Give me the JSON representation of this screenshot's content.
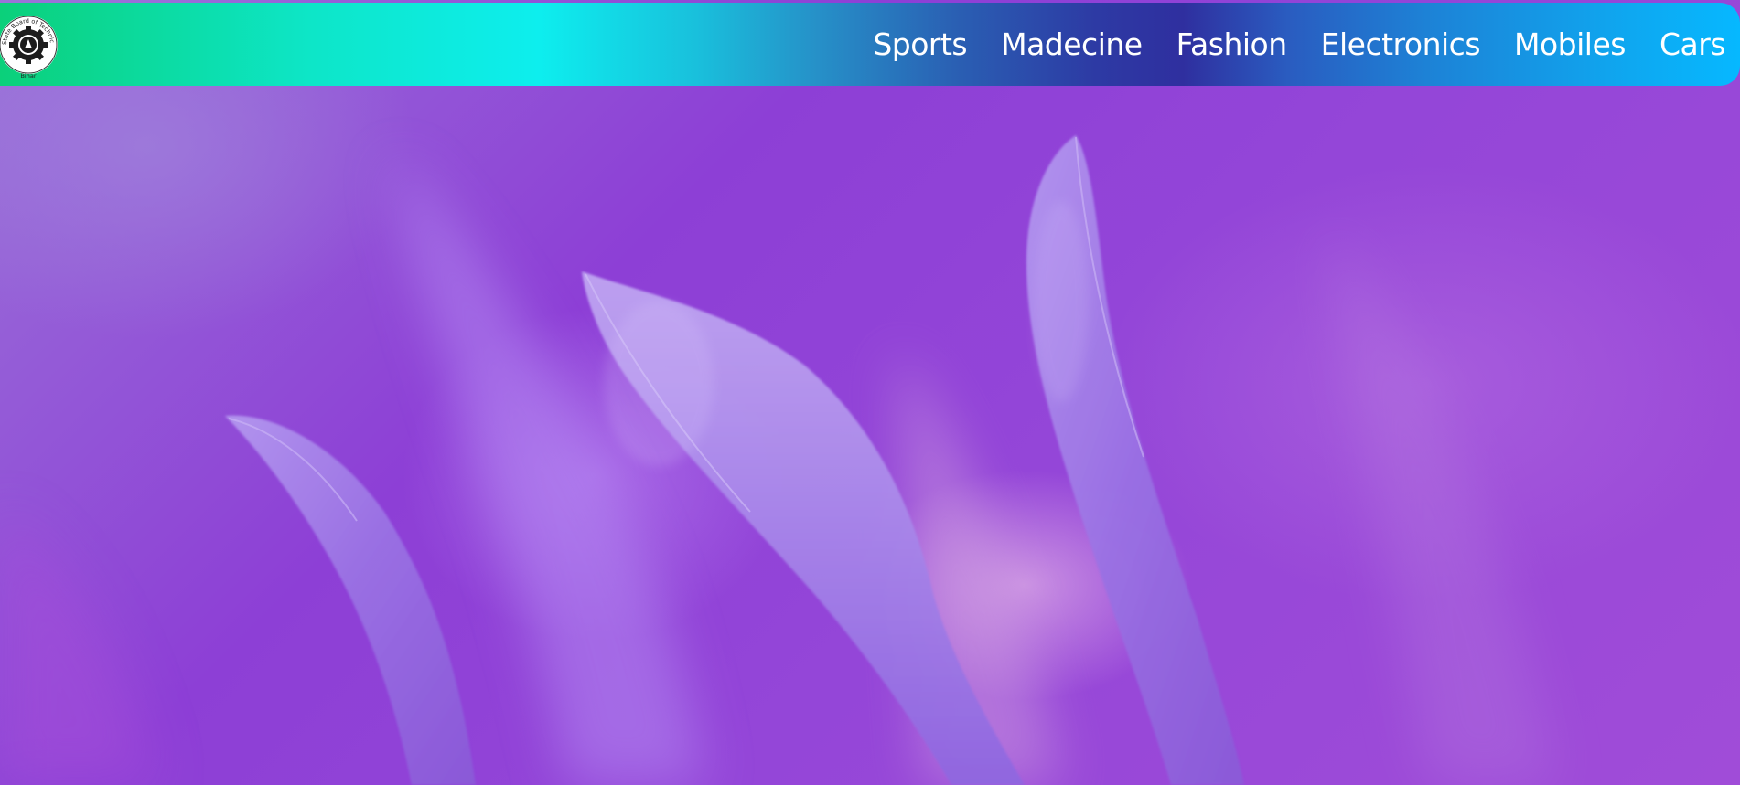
{
  "logo": {
    "ring_text": "State Board of Technical Education",
    "bottom_text": "Bihar"
  },
  "nav": {
    "items": [
      {
        "label": "Sports"
      },
      {
        "label": "Madecine"
      },
      {
        "label": "Fashion"
      },
      {
        "label": "Electronics"
      },
      {
        "label": "Mobiles"
      },
      {
        "label": "Cars"
      }
    ]
  },
  "colors": {
    "nav_gradient_start": "#0bd07a",
    "nav_gradient_mid": "#0deeee",
    "nav_gradient_dark": "#2f2f9f",
    "nav_gradient_end": "#06b8ff",
    "hero_purple": "#8d3fd6",
    "nav_text": "#ffffff"
  }
}
